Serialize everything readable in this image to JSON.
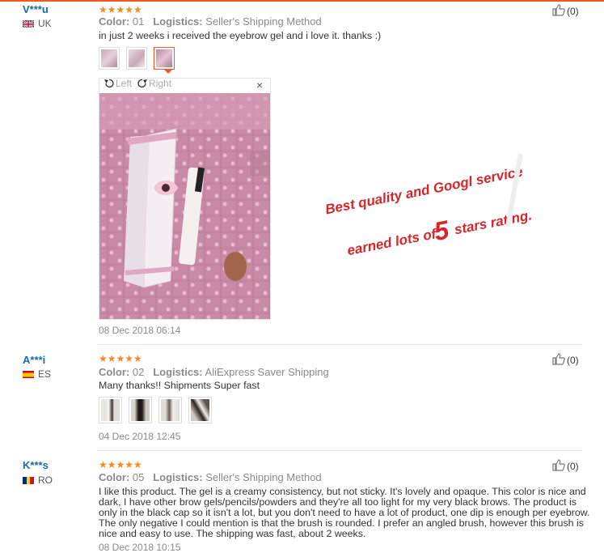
{
  "reviews": [
    {
      "name": "V***u",
      "country": "UK",
      "stars": "★★★★★",
      "color_label": "Color:",
      "color_value": "01",
      "logistics_label": "Logistics:",
      "logistics_value": "Seller's Shipping Method",
      "text": "in just 2 weeks i received the eyebrow gel and i love it. thanks :)",
      "date": "08 Dec 2018 06:14",
      "likes": "(0)"
    },
    {
      "name": "A***i",
      "country": "ES",
      "stars": "★★★★★",
      "color_label": "Color:",
      "color_value": "02",
      "logistics_label": "Logistics:",
      "logistics_value": "AliExpress Saver Shipping",
      "text": "Many thanks!! Shipments Super fast",
      "date": "04 Dec 2018 12:45",
      "likes": "(0)"
    },
    {
      "name": "K***s",
      "country": "RO",
      "stars": "★★★★★",
      "color_label": "Color:",
      "color_value": "05",
      "logistics_label": "Logistics:",
      "logistics_value": "Seller's Shipping Method",
      "text": "I like this product. The gel is a creamy consistency, but not sticky. It's lovely and opaque. This color is nice and dark, I have other brow gels/pencils/powders and they're all too light for my very black brows. The product is only in the black cap so it isn't a lot, but you don't need to have a lot of product, one dip is enough per eyebrow. The only negative I could mention is that the brush is rounded. I prefer an angled brush, however this brush is nice and easy to use. The shipping was fast, about 2 weeks.",
      "date": "08 Dec 2018 10:15",
      "likes": "(0)"
    }
  ],
  "photo_viewer": {
    "rotate_left": "Left",
    "rotate_right": "Right",
    "close": "×"
  },
  "promo": {
    "line1": "Best quality and Googl service",
    "line2_a": "earned lots of",
    "line2_num": "5",
    "line2_b": "stars rating."
  },
  "colors": {
    "accent": "#f05a22",
    "star": "#f58a1f",
    "name": "#1a6aa6",
    "promo": "#d7262b"
  },
  "icons": [
    "thumbs-up-icon",
    "rotate-left-icon",
    "rotate-right-icon",
    "close-icon"
  ]
}
